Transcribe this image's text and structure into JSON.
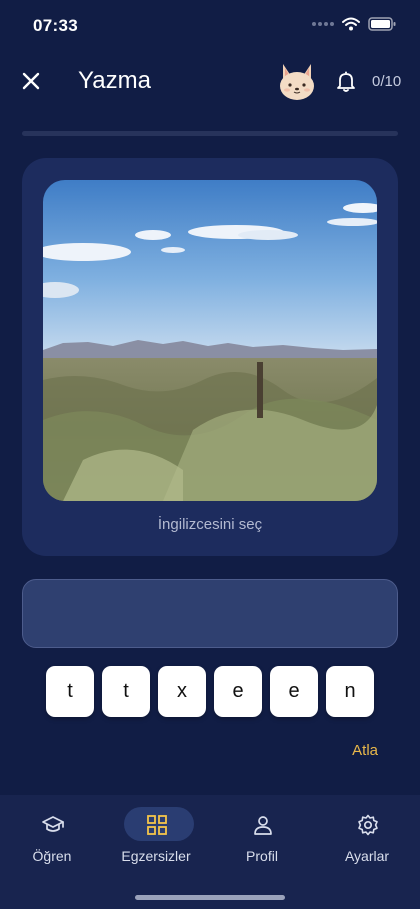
{
  "status": {
    "time": "07:33"
  },
  "header": {
    "title": "Yazma",
    "counter": "0/10",
    "progress": 0
  },
  "card": {
    "caption": "İngilizcesini seç"
  },
  "answer": {
    "value": ""
  },
  "letters": [
    "t",
    "t",
    "x",
    "e",
    "e",
    "n"
  ],
  "skip_label": "Atla",
  "nav": [
    {
      "label": "Öğren",
      "icon": "graduation-cap-icon",
      "active": false
    },
    {
      "label": "Egzersizler",
      "icon": "grid-icon",
      "active": true
    },
    {
      "label": "Profil",
      "icon": "person-icon",
      "active": false
    },
    {
      "label": "Ayarlar",
      "icon": "gear-icon",
      "active": false
    }
  ],
  "colors": {
    "background": "#111d45",
    "card": "#1d2c5e",
    "accent": "#f4c54a",
    "skip": "#e9b84a"
  }
}
